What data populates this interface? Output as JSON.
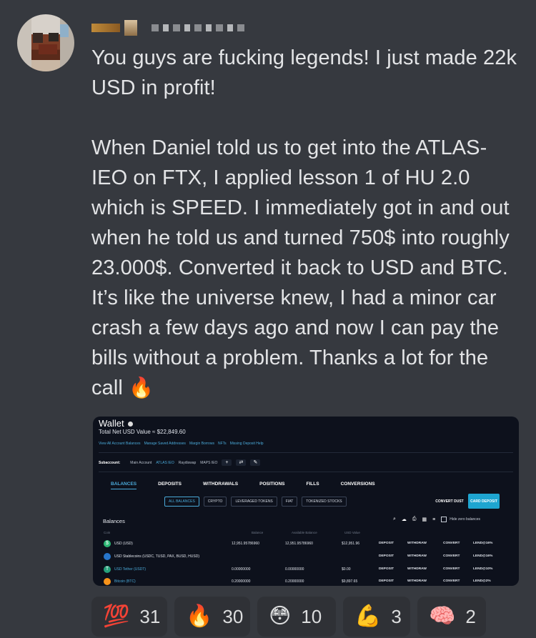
{
  "message": {
    "paragraph1": "You guys are fucking legends! I just made 22k USD in profit!",
    "paragraph2": "When Daniel told us to get into the ATLAS-IEO on FTX, I applied lesson 1 of HU 2.0 which is SPEED. I immediately got in and out when he told us and turned 750$ into roughly 23.000$. Converted it back to USD and BTC. It’s like the universe knew, I had a minor car crash a few days ago and now I can pay the bills without a problem. Thanks a lot for the call",
    "inline_emoji": "🔥"
  },
  "attachment": {
    "title": "Wallet",
    "net_value": "Total Net USD Value ≈ $22,849.60",
    "links": [
      "View All Account Balances",
      "Manage Saved Addresses",
      "Margin Borrows",
      "NFTs",
      "Missing Deposit Help"
    ],
    "subaccount_label": "Subaccount:",
    "subaccounts": [
      "Main Account",
      "ATLAS IEO",
      "Raydiswap",
      "MAPS IEO"
    ],
    "tabs": [
      "BALANCES",
      "DEPOSITS",
      "WITHDRAWALS",
      "POSITIONS",
      "FILLS",
      "CONVERSIONS"
    ],
    "filters": [
      "ALL BALANCES",
      "CRYPTO",
      "LEVERAGED TOKENS",
      "FIAT",
      "TOKENIZED STOCKS"
    ],
    "convert_dust": "CONVERT DUST",
    "card_deposit": "CARD DEPOSIT",
    "balances_title": "Balances",
    "hide_zero": "Hide zero balances",
    "headers": {
      "coin": "Coin",
      "balance": "Balance",
      "available": "Available Balance",
      "usd": "USD Value"
    },
    "rows": [
      {
        "coin": "USD (USD)",
        "balance": "12,951.95786960",
        "available": "12,951.95786960",
        "usd": "$12,951.96",
        "lend": "LEND@16%",
        "coin_color": "#2bb673",
        "glyph": "$"
      },
      {
        "coin": "USD Stablecoins (USDC, TUSD, PAX, BUSD, HUSD)",
        "balance": "",
        "available": "",
        "usd": "",
        "lend": "LEND@16%",
        "coin_color": "#2775ca",
        "glyph": ""
      },
      {
        "coin": "USD Tether (USDT)",
        "balance": "0.00000000",
        "available": "0.00000000",
        "usd": "$0.00",
        "lend": "LEND@10%",
        "coin_color": "#26a17b",
        "glyph": "T"
      },
      {
        "coin": "Bitcoin (BTC)",
        "balance": "0.20000000",
        "available": "0.20000000",
        "usd": "$9,897.65",
        "lend": "LEND@2%",
        "coin_color": "#f7931a",
        "glyph": ""
      }
    ],
    "actions": [
      "DEPOSIT",
      "WITHDRAW",
      "CONVERT"
    ]
  },
  "reactions": [
    {
      "emoji": "💯",
      "count": "31",
      "name": "hundred"
    },
    {
      "emoji": "🔥",
      "count": "30",
      "name": "fire"
    },
    {
      "emoji": "😳",
      "count": "10",
      "name": "flushed"
    },
    {
      "emoji": "💪",
      "count": "3",
      "name": "muscle"
    },
    {
      "emoji": "🧠",
      "count": "2",
      "name": "brain"
    }
  ],
  "colors": {
    "background": "#36393f",
    "reaction_bg": "#2f3136",
    "accent": "#4aa9d8",
    "card_deposit": "#1ea5d0"
  }
}
